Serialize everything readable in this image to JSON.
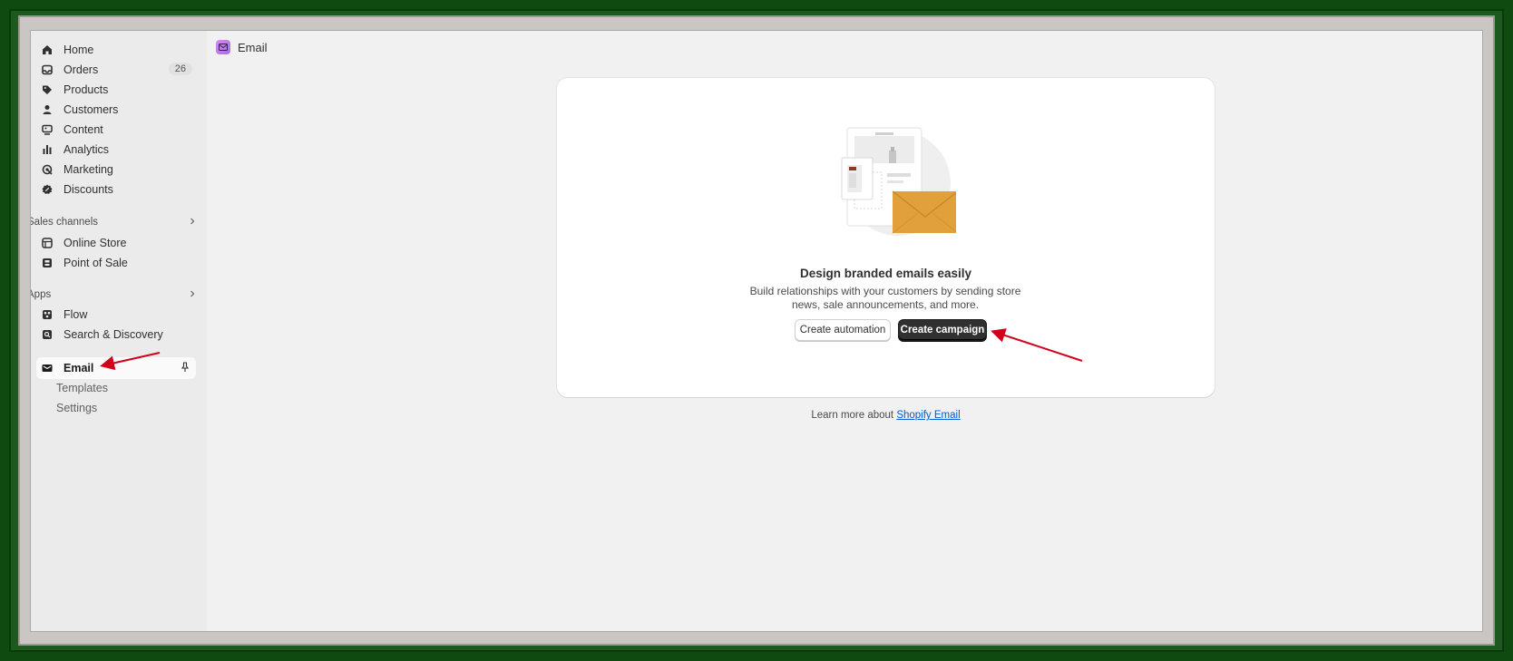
{
  "sidebar": {
    "items": [
      {
        "label": "Home",
        "icon": "home-icon"
      },
      {
        "label": "Orders",
        "icon": "inbox-icon",
        "badge": "26"
      },
      {
        "label": "Products",
        "icon": "tag-icon"
      },
      {
        "label": "Customers",
        "icon": "person-icon"
      },
      {
        "label": "Content",
        "icon": "image-icon"
      },
      {
        "label": "Analytics",
        "icon": "bar-chart-icon"
      },
      {
        "label": "Marketing",
        "icon": "target-icon"
      },
      {
        "label": "Discounts",
        "icon": "discount-icon"
      }
    ],
    "sales_channels": {
      "title": "Sales channels",
      "items": [
        {
          "label": "Online Store",
          "icon": "store-icon"
        },
        {
          "label": "Point of Sale",
          "icon": "pos-icon"
        }
      ]
    },
    "apps": {
      "title": "Apps",
      "items": [
        {
          "label": "Flow",
          "icon": "flow-icon"
        },
        {
          "label": "Search & Discovery",
          "icon": "search-icon"
        }
      ]
    },
    "pinned_app": {
      "label": "Email",
      "icon": "email-icon",
      "sub_items": [
        {
          "label": "Templates"
        },
        {
          "label": "Settings"
        }
      ]
    }
  },
  "header": {
    "title": "Email",
    "icon": "email-app-icon"
  },
  "empty_state": {
    "title": "Design branded emails easily",
    "description": "Build relationships with your customers by sending store news, sale announcements, and more.",
    "secondary_button": "Create automation",
    "primary_button": "Create campaign",
    "illustration": "email-envelope-illustration"
  },
  "footer": {
    "learn_more_text": "Learn more about ",
    "learn_more_link": "Shopify Email"
  },
  "colors": {
    "primary_button": "#303030",
    "link": "#005bd3",
    "annotation_arrow": "#d0021b",
    "frame": "#1d5a1f"
  }
}
